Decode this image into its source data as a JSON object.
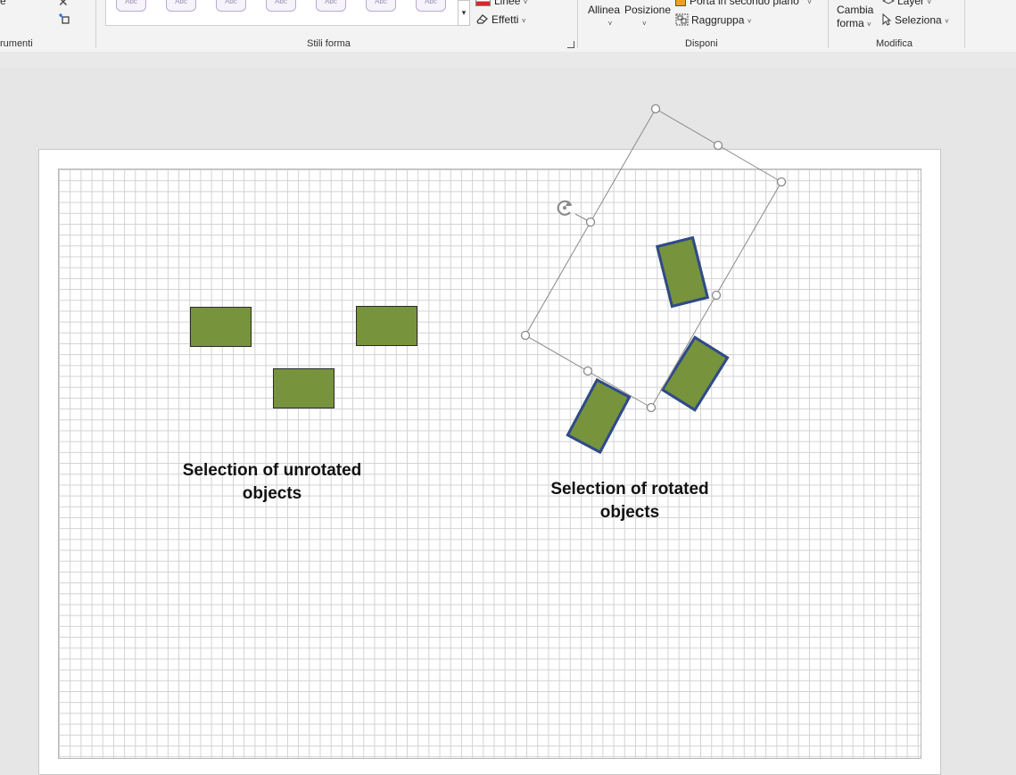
{
  "ribbon": {
    "tools_group_label": "rumenti",
    "tools_partial_left": "e",
    "shape_styles": {
      "group_label": "Stili forma",
      "tile_text": "Abc",
      "lines_label": "Linee",
      "effects_label": "Effetti"
    },
    "arrange": {
      "group_label": "Disponi",
      "align_label": "Allinea",
      "position_label": "Posizione",
      "send_back_label": "Porta in secondo piano",
      "group_button_label": "Raggruppa"
    },
    "modify": {
      "group_label": "Modifica",
      "change_shape_line1": "Cambia",
      "change_shape_line2": "forma",
      "layer_label": "Layer",
      "select_label": "Seleziona"
    }
  },
  "canvas": {
    "caption_left_line1": "Selection of unrotated",
    "caption_left_line2": "objects",
    "caption_right_line1": "Selection of rotated",
    "caption_right_line2": "objects"
  },
  "colors": {
    "shape_fill": "#77933c",
    "shape_border": "#2b2b2b",
    "selected_border": "#2f4a8a"
  }
}
